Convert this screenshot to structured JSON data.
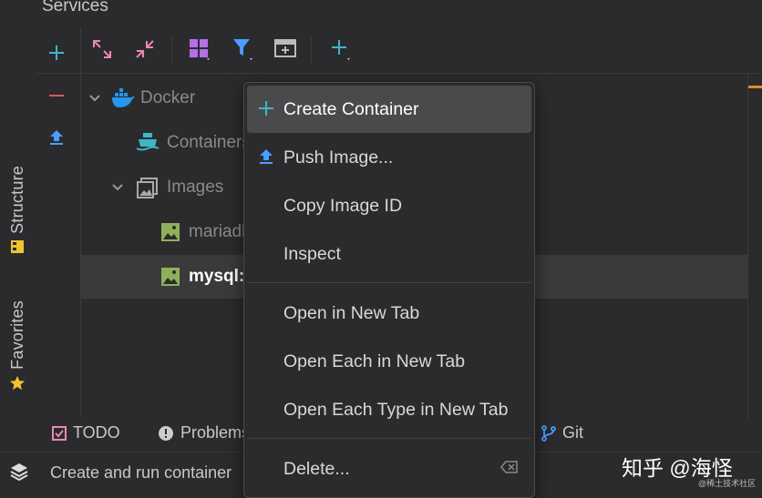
{
  "services": {
    "title": "Services"
  },
  "left_tabs": {
    "structure": "Structure",
    "favorites": "Favorites"
  },
  "tree": {
    "docker": "Docker",
    "containers": "Containers",
    "images": "Images",
    "image1": "mariadb",
    "image2": "mysql:"
  },
  "menu": {
    "create_container": "Create Container",
    "push_image": "Push Image...",
    "copy_image_id": "Copy Image ID",
    "inspect": "Inspect",
    "open_in_new_tab": "Open in New Tab",
    "open_each_in_new_tab": "Open Each in New Tab",
    "open_each_type_in_new_tab": "Open Each Type in New Tab",
    "delete": "Delete..."
  },
  "bottom_tabs": {
    "todo": "TODO",
    "problems": "Problems",
    "git": "Git"
  },
  "status": {
    "text": "Create and run container"
  },
  "watermark": {
    "main": "知乎 @海怪",
    "sub": "@稀土技术社区"
  },
  "colors": {
    "accent_teal": "#3fb6c6",
    "accent_blue": "#4a9eff",
    "selection": "#4a4a4c",
    "purple": "#b56fe8",
    "image_green": "#8fb05a"
  }
}
